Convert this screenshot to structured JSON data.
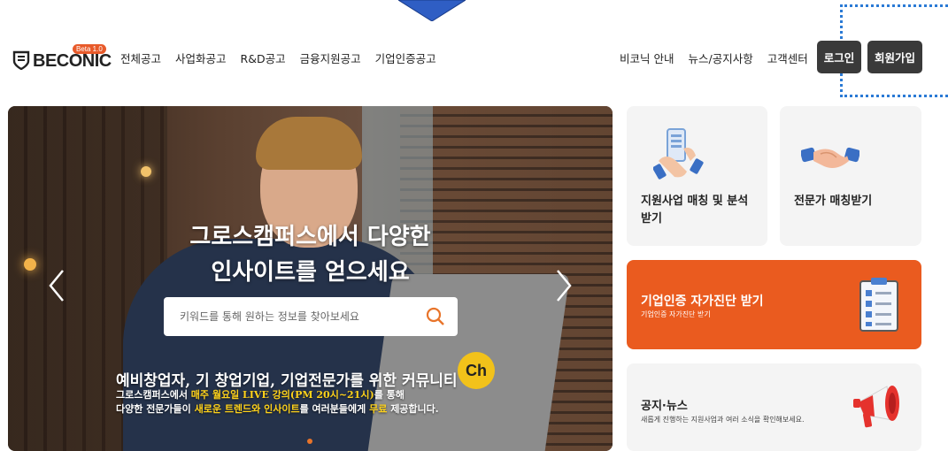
{
  "header": {
    "logo_text": "BECONIC",
    "logo_badge": "Beta 1.0",
    "nav_left": [
      "전체공고",
      "사업화공고",
      "R&D공고",
      "금융지원공고",
      "기업인증공고"
    ],
    "nav_right": [
      "비코닉 안내",
      "뉴스/공지사항",
      "고객센터"
    ],
    "login_label": "로그인",
    "signup_label": "회원가입"
  },
  "hero": {
    "title_line1": "그로스캠퍼스에서 다양한",
    "title_line2": "인사이트를 얻으세요",
    "search_placeholder": "키워드를 통해 원하는 정보를 찾아보세요",
    "sub_line1": "예비창업자, 기 창업기업, 기업전문가를  위한 커뮤니티",
    "sub_line2_prefix": "그로스캠퍼스에서 ",
    "sub_line2_highlight": "매주 월요일 LIVE 강의(PM 20시~21시)",
    "sub_line2_suffix": "를 통해",
    "sub_line3_prefix": "다양한 전문가들이 ",
    "sub_line3_hl1": "새로운 트렌드와 인사이트",
    "sub_line3_mid": "를 여러분들에게 ",
    "sub_line3_hl2": "무료",
    "sub_line3_suffix": " 제공합니다.",
    "ch_badge": "Ch"
  },
  "cards": {
    "match_title": "지원사업 매칭 및 분석 받기",
    "expert_title": "전문가 매칭받기",
    "cert_title": "기업인증 자가진단 받기",
    "cert_sub": "기업인증 자가진단 받기",
    "notice_title": "공지·뉴스",
    "notice_sub": "새롭게 진행하는 지원사업과 여러 소식을 확인해보세요."
  },
  "colors": {
    "accent_orange": "#ea5b1f",
    "dark_button": "#3a3a3a",
    "highlight_yellow": "#ffd21a",
    "annotation_blue": "#2a7ad5"
  }
}
